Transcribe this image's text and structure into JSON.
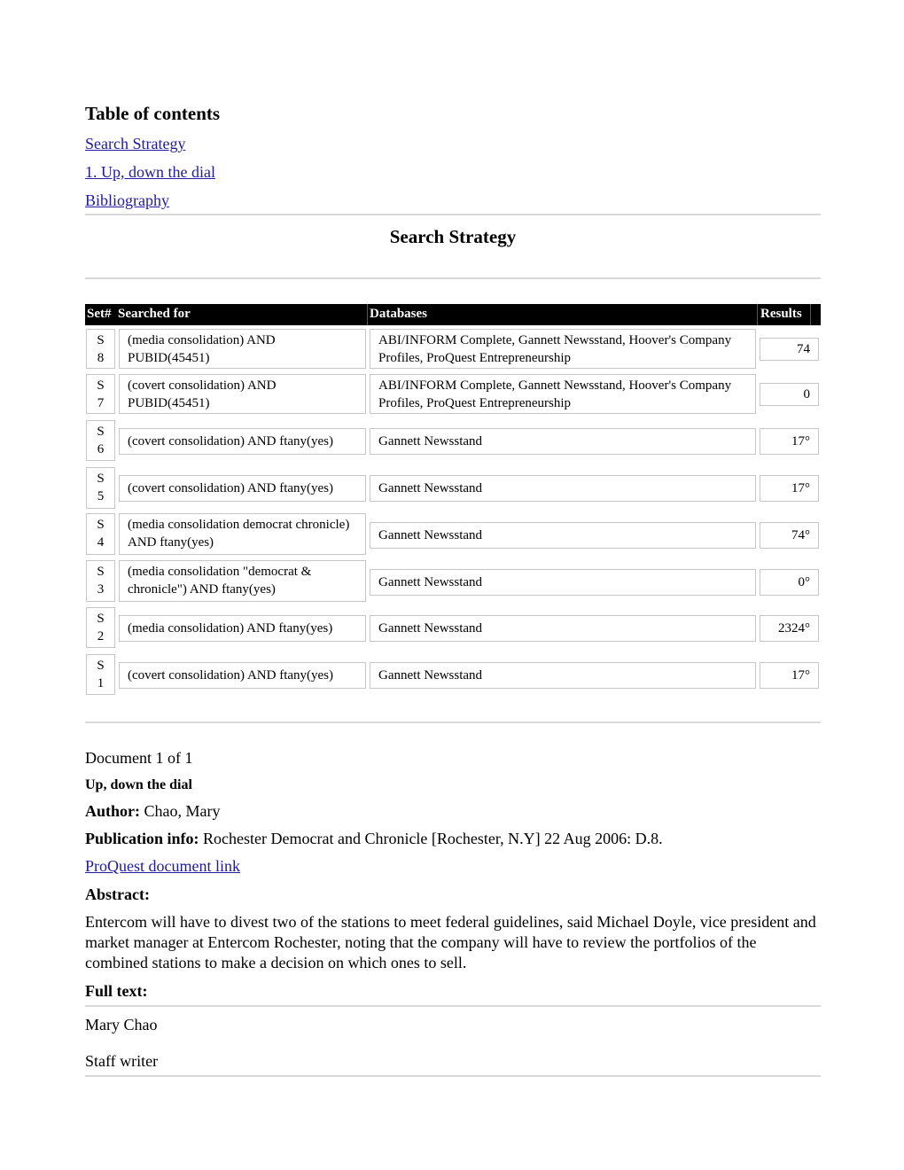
{
  "toc": {
    "title": "Table of contents",
    "links": [
      "Search Strategy",
      "1. Up, down the dial",
      "Bibliography"
    ]
  },
  "search_strategy": {
    "title": "Search Strategy",
    "headers": {
      "set": "Set#",
      "searched_for": "Searched for",
      "databases": "Databases",
      "results": "Results"
    },
    "rows": [
      {
        "set_s": "S",
        "set_n": "8",
        "query": "(media consolidation) AND PUBID(45451)",
        "databases": "ABI/INFORM Complete, Gannett Newsstand, Hoover's Company Profiles, ProQuest Entrepreneurship",
        "results": "74"
      },
      {
        "set_s": "S",
        "set_n": "7",
        "query": "(covert consolidation) AND PUBID(45451)",
        "databases": "ABI/INFORM Complete, Gannett Newsstand, Hoover's Company Profiles, ProQuest Entrepreneurship",
        "results": "0"
      },
      {
        "set_s": "S",
        "set_n": "6",
        "query": "(covert consolidation) AND ftany(yes)",
        "databases": "Gannett Newsstand",
        "results": "17°"
      },
      {
        "set_s": "S",
        "set_n": "5",
        "query": "(covert consolidation) AND ftany(yes)",
        "databases": "Gannett Newsstand",
        "results": "17°"
      },
      {
        "set_s": "S",
        "set_n": "4",
        "query": "(media consolidation democrat chronicle) AND ftany(yes)",
        "databases": "Gannett Newsstand",
        "results": "74°"
      },
      {
        "set_s": "S",
        "set_n": "3",
        "query": "(media consolidation \"democrat & chronicle\") AND ftany(yes)",
        "databases": "Gannett Newsstand",
        "results": "0°"
      },
      {
        "set_s": "S",
        "set_n": "2",
        "query": "(media consolidation) AND ftany(yes)",
        "databases": "Gannett Newsstand",
        "results": "2324°"
      },
      {
        "set_s": "S",
        "set_n": "1",
        "query": "(covert consolidation) AND ftany(yes)",
        "databases": "Gannett Newsstand",
        "results": "17°"
      }
    ]
  },
  "document": {
    "count": "Document 1 of 1",
    "title": "Up, down the dial",
    "author_label": "Author:",
    "author": "Chao, Mary",
    "pub_label": "Publication info:",
    "pub": "Rochester Democrat and Chronicle [Rochester, N.Y] 22 Aug 2006: D.8.",
    "link": "ProQuest document link",
    "abstract_label": "Abstract:",
    "abstract": "Entercom will have to divest two of the stations to meet federal guidelines, said Michael Doyle, vice president and market manager at Entercom Rochester, noting that the company will have to review the portfolios of the combined stations to make a decision on which ones to sell.",
    "fulltext_label": "Full text:",
    "fulltext_lines": [
      "Mary Chao",
      "Staff writer"
    ]
  }
}
